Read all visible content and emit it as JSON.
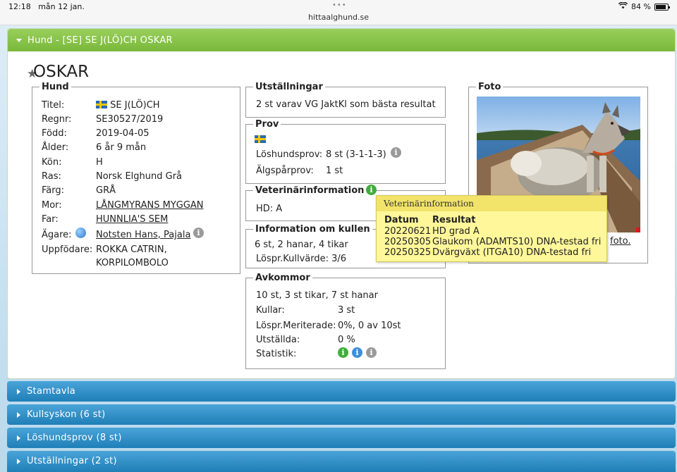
{
  "status": {
    "time": "12:18",
    "date": "mån 12 jan.",
    "url": "hittaalghund.se",
    "battery": "84 %"
  },
  "header": {
    "title": "Hund - [SE] SE J(LÖ)CH OSKAR"
  },
  "dog": {
    "name": "OSKAR"
  },
  "hund": {
    "legend": "Hund",
    "titel_label": "Titel:",
    "titel": "SE J(LÖ)CH",
    "regnr_label": "Regnr:",
    "regnr": "SE30527/2019",
    "fodd_label": "Född:",
    "fodd": "2019-04-05",
    "alder_label": "Ålder:",
    "alder": "6 år 9 mån",
    "kon_label": "Kön:",
    "kon": "H",
    "ras_label": "Ras:",
    "ras": "Norsk Elghund Grå",
    "farg_label": "Färg:",
    "farg": "GRÅ",
    "mor_label": "Mor:",
    "mor": "LÅNGMYRANS MYGGAN",
    "far_label": "Far:",
    "far": "HUNNLIA'S SEM",
    "agare_label": "Ägare:",
    "agare": "Notsten Hans, Pajala",
    "uppfodare_label": "Uppfödare:",
    "uppfodare_1": "ROKKA CATRIN,",
    "uppfodare_2": "KORPILOMBOLO"
  },
  "utstallningar": {
    "legend": "Utställningar",
    "text": "2 st varav VG JaktKl som bästa resultat"
  },
  "prov": {
    "legend": "Prov",
    "loshund_label": "Löshundsprov:",
    "loshund": "8 st (3-1-1-3)",
    "algspar_label": "Älgspårprov:",
    "algspar": "1 st"
  },
  "veterinar": {
    "legend": "Veterinärinformation",
    "hd": "HD: A"
  },
  "kullen": {
    "legend": "Information om kullen",
    "text": "6 st, 2 hanar, 4 tikar",
    "kullvarde": "Löspr.Kullvärde: 3/6"
  },
  "avkommor": {
    "legend": "Avkommor",
    "text": "10 st, 3 st tikar, 7 st hanar",
    "kullar_label": "Kullar:",
    "kullar": "3 st",
    "meriterade_label": "Löspr.Meriterade:",
    "meriterade": "0%, 0 av 10st",
    "utstallda_label": "Utställda:",
    "utstallda": "0 %",
    "statistik_label": "Statistik:"
  },
  "foto": {
    "legend": "Foto",
    "link": "foto."
  },
  "tooltip": {
    "title": "Veterinärinformation",
    "col_datum": "Datum",
    "col_resultat": "Resultat",
    "rows": [
      {
        "datum": "20220621",
        "resultat": "HD grad A"
      },
      {
        "datum": "20250305",
        "resultat": "Glaukom (ADAMTS10) DNA-testad fri"
      },
      {
        "datum": "20250325",
        "resultat": "Dvärgväxt (ITGA10) DNA-testad fri"
      }
    ]
  },
  "sections": [
    {
      "label": "Stamtavla"
    },
    {
      "label": "Kullsyskon (6 st)"
    },
    {
      "label": "Löshundsprov (8 st)"
    },
    {
      "label": "Utställningar (2 st)"
    }
  ],
  "colors": {
    "header_green": "#79b83a",
    "section_blue": "#1f7fb7",
    "tooltip_yellow": "#fff79a"
  }
}
